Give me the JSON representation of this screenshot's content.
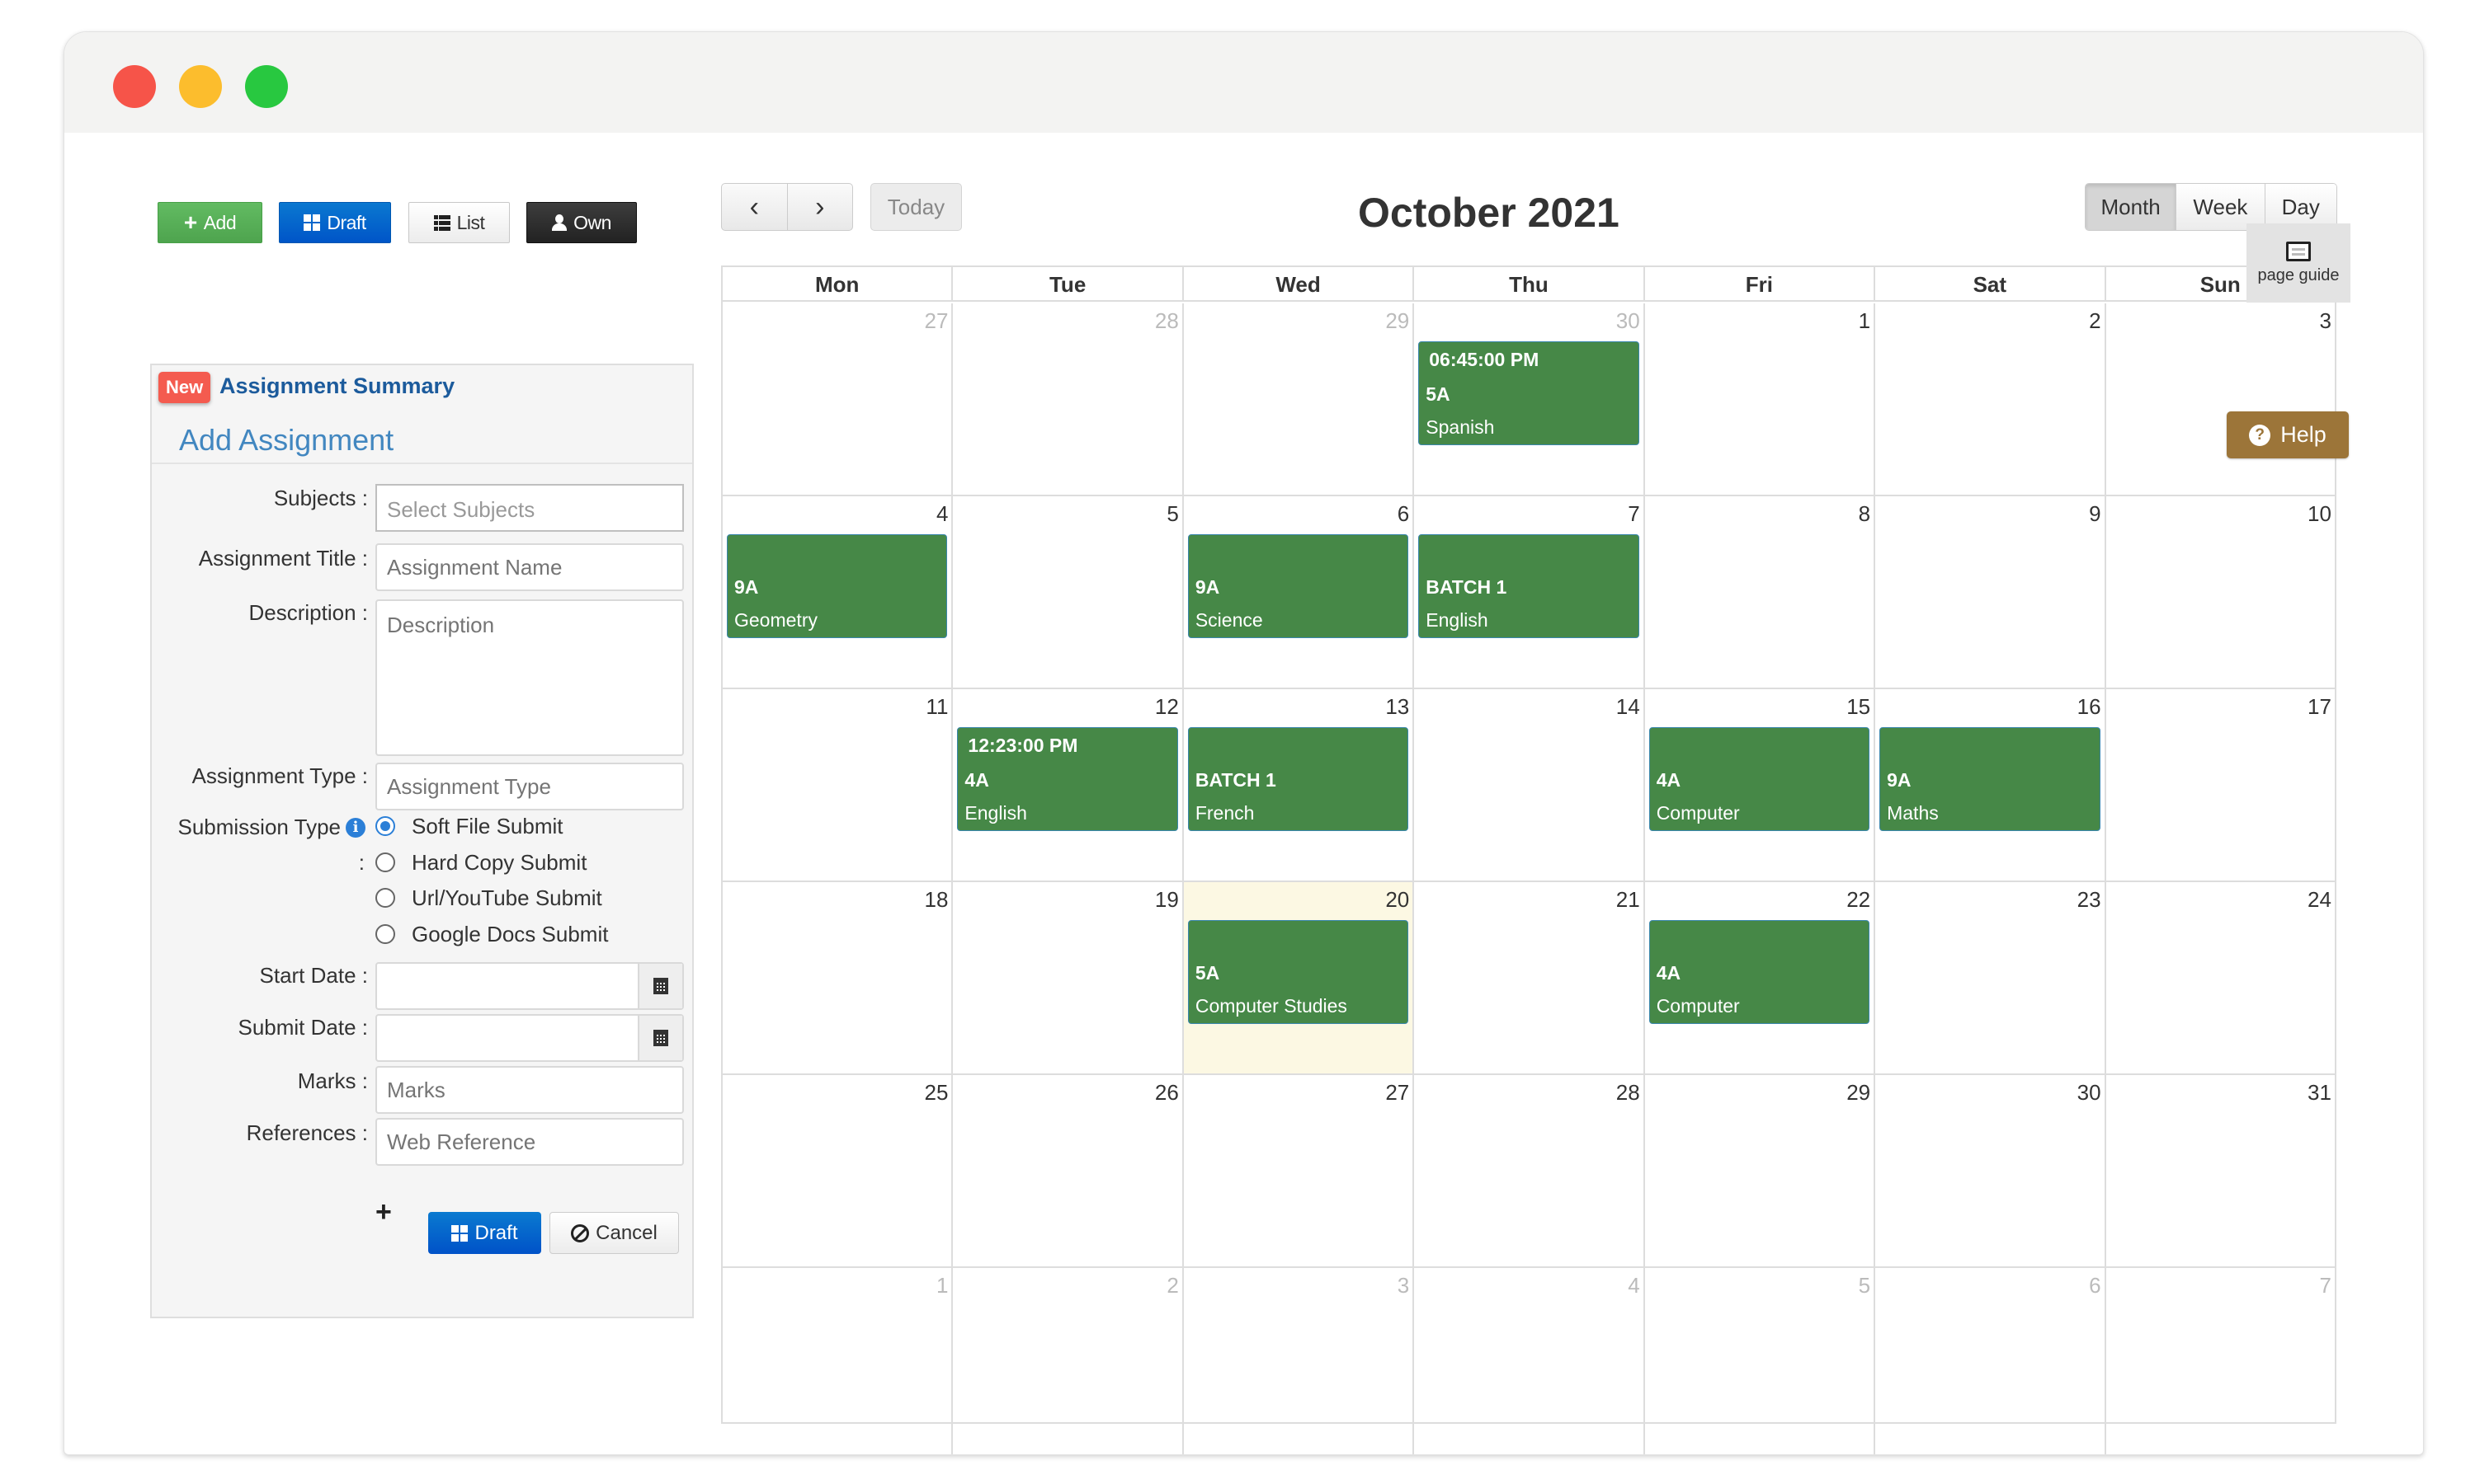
{
  "toolbar": {
    "add_label": "Add",
    "draft_label": "Draft",
    "list_label": "List",
    "own_label": "Own"
  },
  "panel": {
    "badge": "New",
    "summary_link": "Assignment Summary",
    "title": "Add Assignment",
    "fields": {
      "subjects": {
        "label": "Subjects :",
        "placeholder": "Select Subjects"
      },
      "title": {
        "label": "Assignment Title :",
        "placeholder": "Assignment Name"
      },
      "description": {
        "label": "Description :",
        "placeholder": "Description"
      },
      "type": {
        "label": "Assignment Type :",
        "placeholder": "Assignment Type"
      },
      "submission": {
        "label": "Submission Type",
        "colon": ":",
        "options": [
          {
            "label": "Soft File Submit",
            "checked": true
          },
          {
            "label": "Hard Copy Submit",
            "checked": false
          },
          {
            "label": "Url/YouTube Submit",
            "checked": false
          },
          {
            "label": "Google Docs Submit",
            "checked": false
          }
        ]
      },
      "start_date": {
        "label": "Start Date :",
        "value": ""
      },
      "submit_date": {
        "label": "Submit Date :",
        "value": ""
      },
      "marks": {
        "label": "Marks :",
        "placeholder": "Marks"
      },
      "references": {
        "label": "References :",
        "placeholder": "Web Reference"
      }
    },
    "add_reference_icon": "+",
    "draft_label": "Draft",
    "cancel_label": "Cancel"
  },
  "calendar": {
    "prev_icon": "‹",
    "next_icon": "›",
    "today_label": "Today",
    "title": "October 2021",
    "views": [
      {
        "label": "Month",
        "active": true
      },
      {
        "label": "Week",
        "active": false
      },
      {
        "label": "Day",
        "active": false
      }
    ],
    "page_guide_label": "page guide",
    "help_label": "Help",
    "weekdays": [
      "Mon",
      "Tue",
      "Wed",
      "Thu",
      "Fri",
      "Sat",
      "Sun"
    ],
    "weeks": [
      [
        {
          "d": "27",
          "other": true
        },
        {
          "d": "28",
          "other": true
        },
        {
          "d": "29",
          "other": true
        },
        {
          "d": "30",
          "other": true,
          "event": {
            "time": "06:45:00 PM",
            "cls": "5A",
            "subject": "Spanish"
          }
        },
        {
          "d": "1"
        },
        {
          "d": "2"
        },
        {
          "d": "3"
        }
      ],
      [
        {
          "d": "4",
          "event": {
            "time": "",
            "cls": "9A",
            "subject": "Geometry"
          }
        },
        {
          "d": "5"
        },
        {
          "d": "6",
          "event": {
            "time": "",
            "cls": "9A",
            "subject": "Science"
          }
        },
        {
          "d": "7",
          "event": {
            "time": "",
            "cls": "BATCH 1",
            "subject": "English"
          }
        },
        {
          "d": "8"
        },
        {
          "d": "9"
        },
        {
          "d": "10"
        }
      ],
      [
        {
          "d": "11"
        },
        {
          "d": "12",
          "event": {
            "time": "12:23:00 PM",
            "cls": "4A",
            "subject": "English"
          }
        },
        {
          "d": "13",
          "event": {
            "time": "",
            "cls": "BATCH 1",
            "subject": "French"
          }
        },
        {
          "d": "14"
        },
        {
          "d": "15",
          "event": {
            "time": "",
            "cls": "4A",
            "subject": "Computer"
          }
        },
        {
          "d": "16",
          "event": {
            "time": "",
            "cls": "9A",
            "subject": "Maths"
          }
        },
        {
          "d": "17"
        }
      ],
      [
        {
          "d": "18"
        },
        {
          "d": "19"
        },
        {
          "d": "20",
          "today": true,
          "event": {
            "time": "",
            "cls": "5A",
            "subject": "Computer Studies"
          }
        },
        {
          "d": "21"
        },
        {
          "d": "22",
          "event": {
            "time": "",
            "cls": "4A",
            "subject": "Computer"
          }
        },
        {
          "d": "23"
        },
        {
          "d": "24"
        }
      ],
      [
        {
          "d": "25"
        },
        {
          "d": "26"
        },
        {
          "d": "27"
        },
        {
          "d": "28"
        },
        {
          "d": "29"
        },
        {
          "d": "30"
        },
        {
          "d": "31"
        }
      ],
      [
        {
          "d": "1",
          "other": true
        },
        {
          "d": "2",
          "other": true
        },
        {
          "d": "3",
          "other": true
        },
        {
          "d": "4",
          "other": true
        },
        {
          "d": "5",
          "other": true
        },
        {
          "d": "6",
          "other": true
        },
        {
          "d": "7",
          "other": true
        }
      ]
    ]
  },
  "colors": {
    "event_green": "#468847",
    "today_bg": "#fcf8e3",
    "help_brown": "#9c7539",
    "primary_blue": "#0a78d0",
    "add_green": "#5cb85c",
    "badge_red": "#f45b4f"
  }
}
